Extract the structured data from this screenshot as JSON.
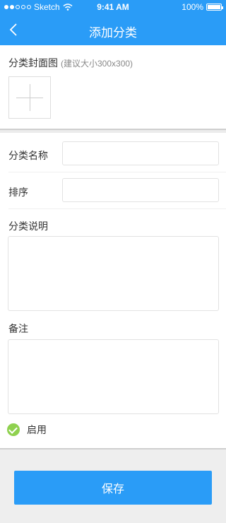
{
  "status_bar": {
    "carrier": "Sketch",
    "time": "9:41 AM",
    "battery": "100%"
  },
  "nav": {
    "title": "添加分类",
    "back_icon": "chevron-left-icon"
  },
  "cover": {
    "label": "分类封面图",
    "hint": "(建议大小300x300)",
    "upload_icon": "plus-icon"
  },
  "form": {
    "name_label": "分类名称",
    "name_value": "",
    "sort_label": "排序",
    "sort_value": "",
    "description_label": "分类说明",
    "description_value": "",
    "remark_label": "备注",
    "remark_value": "",
    "enable_label": "启用",
    "enable_checked": true
  },
  "footer": {
    "save_label": "保存"
  },
  "colors": {
    "primary": "#2a9cf7",
    "check": "#8fd14f"
  }
}
